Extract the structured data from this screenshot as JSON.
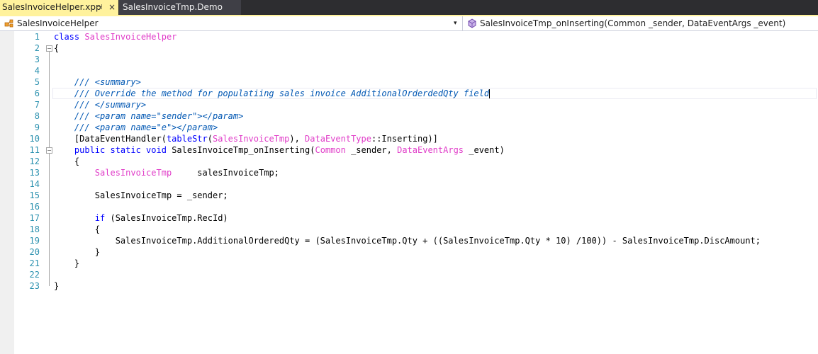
{
  "tabs": {
    "active": {
      "label": "SalesInvoiceHelper.xpp",
      "pin": "⊣",
      "close": "×"
    },
    "inactive": {
      "label": "SalesInvoiceTmp.Demo"
    }
  },
  "nav": {
    "class_selector": "SalesInvoiceHelper",
    "class_arrow": "▾",
    "member_selector": "SalesInvoiceTmp_onInserting(Common _sender, DataEventArgs _event)"
  },
  "colors": {
    "keyword": "#0000ff",
    "type": "#e03cc8",
    "comment": "#0057b3",
    "line_number": "#2b91af",
    "active_tab": "#fff29d"
  },
  "editor": {
    "line_numbers": [
      "1",
      "2",
      "3",
      "4",
      "5",
      "6",
      "7",
      "8",
      "9",
      "10",
      "11",
      "12",
      "13",
      "14",
      "15",
      "16",
      "17",
      "18",
      "19",
      "20",
      "21",
      "22",
      "23"
    ],
    "cursor_line": "6",
    "lines": [
      {
        "n": "1",
        "segs": [
          {
            "t": "class ",
            "c": "kw"
          },
          {
            "t": "SalesInvoiceHelper",
            "c": "ty"
          }
        ]
      },
      {
        "n": "2",
        "segs": [
          {
            "t": "{",
            "c": "nm"
          }
        ]
      },
      {
        "n": "3",
        "segs": []
      },
      {
        "n": "4",
        "segs": []
      },
      {
        "n": "5",
        "segs": [
          {
            "t": "    /// <summary>",
            "c": "cm"
          }
        ]
      },
      {
        "n": "6",
        "segs": [
          {
            "t": "    /// Override the method for populatiing sales invoice AdditionalOrderdedQty field",
            "c": "cm"
          }
        ]
      },
      {
        "n": "7",
        "segs": [
          {
            "t": "    /// </summary>",
            "c": "cm"
          }
        ]
      },
      {
        "n": "8",
        "segs": [
          {
            "t": "    /// <param name=\"sender\"></param>",
            "c": "cm"
          }
        ]
      },
      {
        "n": "9",
        "segs": [
          {
            "t": "    /// <param name=\"e\"></param>",
            "c": "cm"
          }
        ]
      },
      {
        "n": "10",
        "segs": [
          {
            "t": "    [DataEventHandler(",
            "c": "nm"
          },
          {
            "t": "tableStr",
            "c": "kw"
          },
          {
            "t": "(",
            "c": "nm"
          },
          {
            "t": "SalesInvoiceTmp",
            "c": "ty"
          },
          {
            "t": "), ",
            "c": "nm"
          },
          {
            "t": "DataEventType",
            "c": "ty"
          },
          {
            "t": "::Inserting)]",
            "c": "nm"
          }
        ]
      },
      {
        "n": "11",
        "segs": [
          {
            "t": "    ",
            "c": "nm"
          },
          {
            "t": "public static void ",
            "c": "kw"
          },
          {
            "t": "SalesInvoiceTmp_onInserting(",
            "c": "nm"
          },
          {
            "t": "Common",
            "c": "ty"
          },
          {
            "t": " _sender, ",
            "c": "nm"
          },
          {
            "t": "DataEventArgs",
            "c": "ty"
          },
          {
            "t": " _event)",
            "c": "nm"
          }
        ]
      },
      {
        "n": "12",
        "segs": [
          {
            "t": "    {",
            "c": "nm"
          }
        ]
      },
      {
        "n": "13",
        "segs": [
          {
            "t": "        ",
            "c": "nm"
          },
          {
            "t": "SalesInvoiceTmp",
            "c": "ty"
          },
          {
            "t": "     salesInvoiceTmp;",
            "c": "nm"
          }
        ]
      },
      {
        "n": "14",
        "segs": []
      },
      {
        "n": "15",
        "segs": [
          {
            "t": "        SalesInvoiceTmp = _sender;",
            "c": "nm"
          }
        ]
      },
      {
        "n": "16",
        "segs": []
      },
      {
        "n": "17",
        "segs": [
          {
            "t": "        ",
            "c": "nm"
          },
          {
            "t": "if",
            "c": "kw"
          },
          {
            "t": " (SalesInvoiceTmp.RecId)",
            "c": "nm"
          }
        ]
      },
      {
        "n": "18",
        "segs": [
          {
            "t": "        {",
            "c": "nm"
          }
        ]
      },
      {
        "n": "19",
        "segs": [
          {
            "t": "            SalesInvoiceTmp.AdditionalOrderedQty = (SalesInvoiceTmp.Qty + ((SalesInvoiceTmp.Qty * 10) /100)) - SalesInvoiceTmp.DiscAmount;",
            "c": "nm"
          }
        ]
      },
      {
        "n": "20",
        "segs": [
          {
            "t": "        }",
            "c": "nm"
          }
        ]
      },
      {
        "n": "21",
        "segs": [
          {
            "t": "    }",
            "c": "nm"
          }
        ]
      },
      {
        "n": "22",
        "segs": []
      },
      {
        "n": "23",
        "segs": [
          {
            "t": "}",
            "c": "nm"
          }
        ]
      }
    ]
  }
}
